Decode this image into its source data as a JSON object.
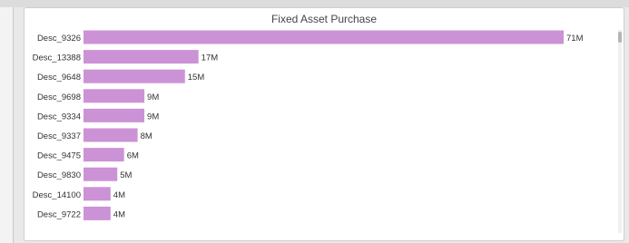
{
  "chart_data": {
    "type": "bar",
    "orientation": "horizontal",
    "title": "Fixed Asset Purchase",
    "categories": [
      "Desc_9326",
      "Desc_13388",
      "Desc_9648",
      "Desc_9698",
      "Desc_9334",
      "Desc_9337",
      "Desc_9475",
      "Desc_9830",
      "Desc_14100",
      "Desc_9722"
    ],
    "values": [
      71,
      17,
      15,
      9,
      9,
      8,
      6,
      5,
      4,
      4
    ],
    "value_labels": [
      "71M",
      "17M",
      "15M",
      "9M",
      "9M",
      "8M",
      "6M",
      "5M",
      "4M",
      "4M"
    ],
    "bar_color": "#cc92d6",
    "grid": false,
    "legend": "none"
  }
}
